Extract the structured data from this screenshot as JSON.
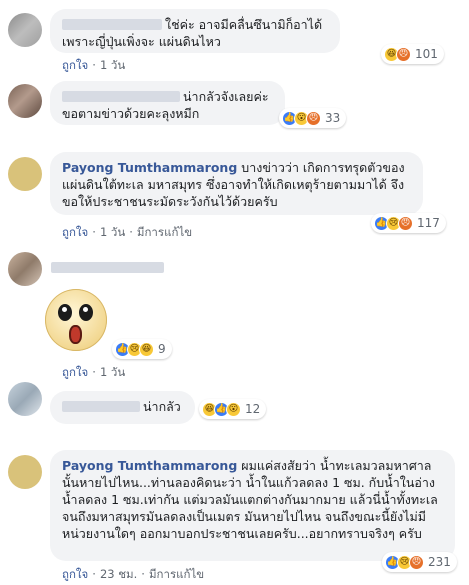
{
  "comments": [
    {
      "text": "ใช่ค่ะ อาจมีคลื่นซึนามิก็อาได้ เพราะญี่ปุ่นเพิ่งจะ แผ่นดินไหว",
      "reaction_count": "101",
      "like": "ถูกใจ",
      "time": "1 วัน"
    },
    {
      "text": "น่ากลัวจังเลยค่ะ ขอตามข่าวด้วยคะลุงหมีก",
      "reaction_count": "33",
      "like": "ถูกใจ",
      "time": "1 วัน"
    },
    {
      "author": "Payong Tumthammarong",
      "text": "บางข่าวว่า เกิดการทรุดตัวของแผ่นดินใต้ทะเล มหาสมุทร ซึ่งอาจทำให้เกิดเหตุร้ายตามมาได้ จึงขอให้ประชาชนระมัดระวังกันไว้ด้วยครับ",
      "reaction_count": "117",
      "like": "ถูกใจ",
      "time": "1 วัน",
      "edited": "มีการแก้ไข"
    },
    {
      "reaction_count": "9",
      "like": "ถูกใจ",
      "time": "1 วัน"
    },
    {
      "text": "น่ากลัว",
      "reaction_count": "12",
      "like": "ถูกใจ",
      "time": "1 วัน"
    },
    {
      "author": "Payong Tumthammarong",
      "text": "ผมแค่สงสัยว่า น้ำทะเลมวลมหาศาลนั้นหายไปไหน...ท่านลองคิดนะว่า น้ำในแก้วลดลง 1 ซม. กับน้ำในอ่างน้ำลดลง 1 ซม.เท่ากัน แต่มวลมันแตกต่างกันมากมาย แล้วนี่น้ำทั้งทะเล จนถึงมหาสมุทรมันลดลงเป็นเมตร มันหายไปไหน จนถึงขณะนี้ยังไม่มีหน่วยงานใดๆ ออกมาบอกประชาชนเลยครับ...อยากทราบจริงๆ ครับ",
      "reaction_count": "231",
      "like": "ถูกใจ",
      "time": "23 ชม.",
      "edited": "มีการแก้ไข"
    }
  ]
}
